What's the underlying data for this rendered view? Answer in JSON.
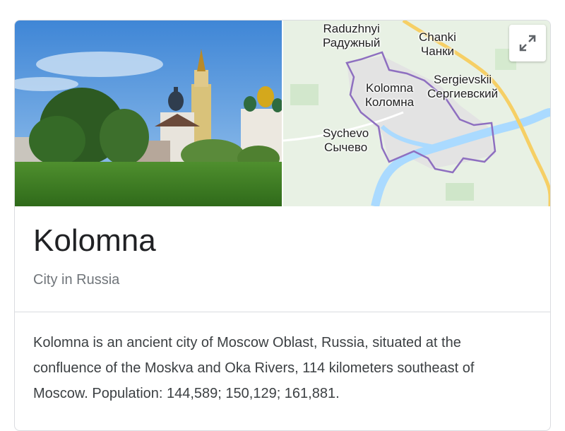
{
  "entity": {
    "title": "Kolomna",
    "subtitle": "City in Russia",
    "description": "Kolomna is an ancient city of Moscow Oblast, Russia, situated at the confluence of the Moskva and Oka Rivers, 114 kilometers southeast of Moscow. Population: 144,589; 150,129; 161,881."
  },
  "map": {
    "labels": {
      "raduzhnyi_latin": "Raduzhnyi",
      "raduzhnyi_cyrillic": "Радужный",
      "chanki_latin": "Chanki",
      "chanki_cyrillic": "Чанки",
      "sergievskii_latin": "Sergievskii",
      "sergievskii_cyrillic": "Сергиевский",
      "kolomna_latin": "Kolomna",
      "kolomna_cyrillic": "Коломна",
      "sychevo_latin": "Sychevo",
      "sychevo_cyrillic": "Сычево"
    },
    "expand_icon": "expand-icon",
    "colors": {
      "land": "#e8f1e4",
      "water": "#aadaff",
      "road": "#f6cf65",
      "boundary": "#8e6fc0"
    }
  },
  "photo": {
    "subject": "photo-kolomna-kremlin-cathedrals"
  }
}
